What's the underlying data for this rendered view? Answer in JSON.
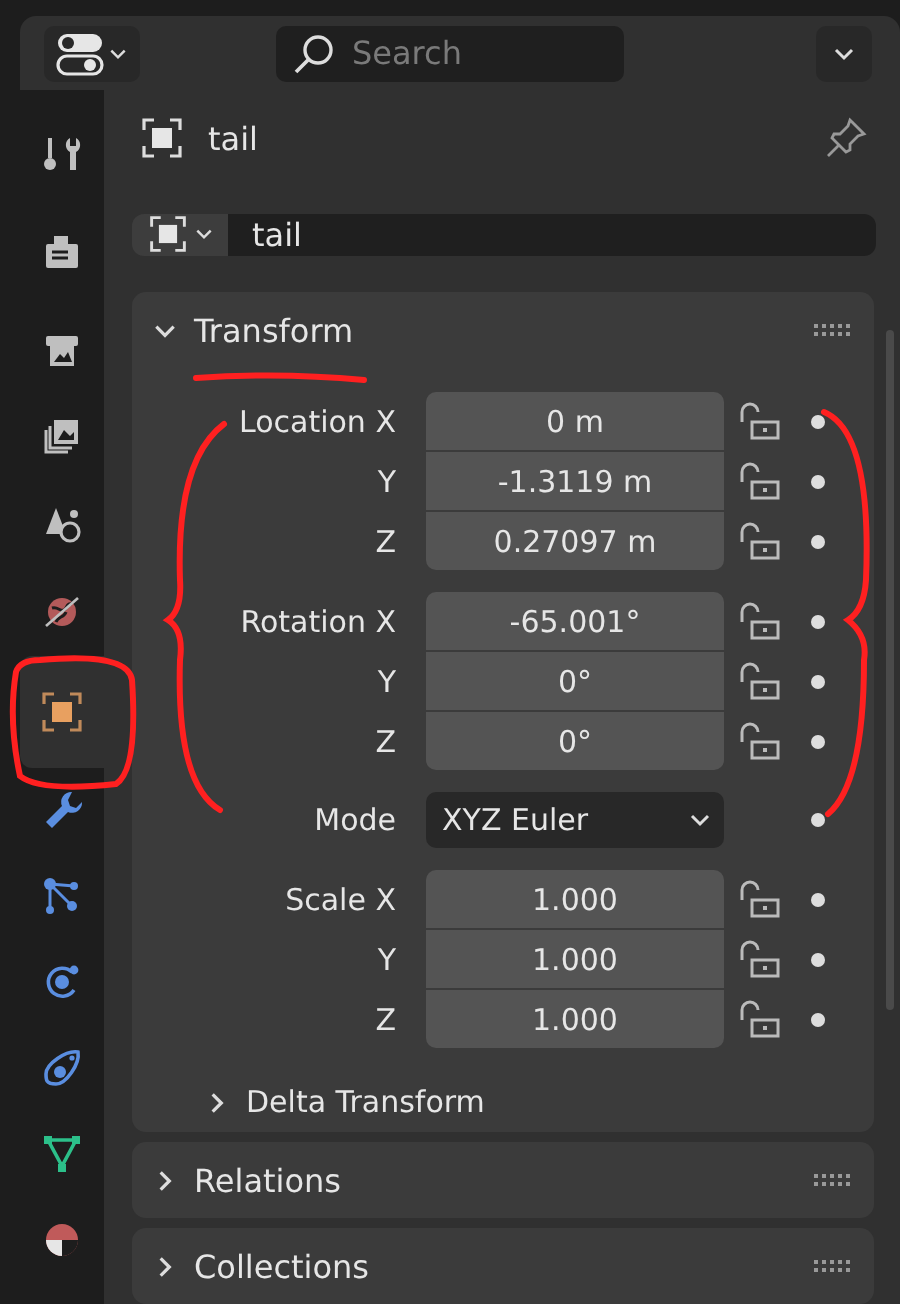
{
  "search": {
    "placeholder": "Search"
  },
  "tabs": [
    {
      "kind": "tool",
      "selected": false
    },
    {
      "kind": "render",
      "selected": false
    },
    {
      "kind": "output",
      "selected": false
    },
    {
      "kind": "view_layer",
      "selected": false
    },
    {
      "kind": "scene",
      "selected": false
    },
    {
      "kind": "world",
      "selected": false
    },
    {
      "kind": "object",
      "selected": true
    },
    {
      "kind": "modifiers",
      "selected": false
    },
    {
      "kind": "particles",
      "selected": false
    },
    {
      "kind": "physics",
      "selected": false
    },
    {
      "kind": "constraints",
      "selected": false
    },
    {
      "kind": "data",
      "selected": false
    },
    {
      "kind": "material",
      "selected": false
    }
  ],
  "object": {
    "name": "tail"
  },
  "datablock": {
    "value": "tail"
  },
  "panels": [
    {
      "title": "Transform",
      "expanded": true,
      "groups": [
        {
          "rows": [
            {
              "kind": "number",
              "label": "Location X",
              "value": "0 m",
              "locked": false
            },
            {
              "kind": "number",
              "label": "Y",
              "value": "-1.3119 m",
              "locked": false
            },
            {
              "kind": "number",
              "label": "Z",
              "value": "0.27097 m",
              "locked": false
            }
          ]
        },
        {
          "rows": [
            {
              "kind": "number",
              "label": "Rotation X",
              "value": "-65.001°",
              "locked": false
            },
            {
              "kind": "number",
              "label": "Y",
              "value": "0°",
              "locked": false
            },
            {
              "kind": "number",
              "label": "Z",
              "value": "0°",
              "locked": false
            }
          ]
        },
        {
          "rows": [
            {
              "kind": "dropdown",
              "label": "Mode",
              "value": "XYZ Euler"
            }
          ]
        },
        {
          "rows": [
            {
              "kind": "number",
              "label": "Scale X",
              "value": "1.000",
              "locked": false
            },
            {
              "kind": "number",
              "label": "Y",
              "value": "1.000",
              "locked": false
            },
            {
              "kind": "number",
              "label": "Z",
              "value": "1.000",
              "locked": false
            }
          ]
        }
      ],
      "subpanels": [
        {
          "title": "Delta Transform",
          "expanded": false
        }
      ]
    },
    {
      "title": "Relations",
      "expanded": false
    },
    {
      "title": "Collections",
      "expanded": false
    }
  ]
}
